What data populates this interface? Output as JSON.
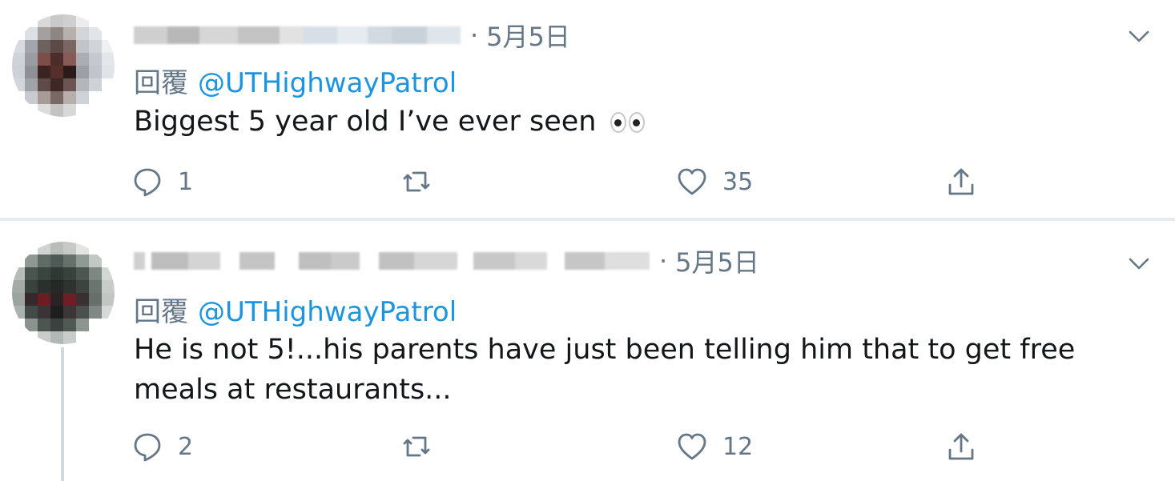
{
  "tweets": [
    {
      "separator": "·",
      "date": "5月5日",
      "reply_prefix": "回覆",
      "reply_handle": "@UTHighwayPatrol",
      "text": "Biggest 5 year old I’ve ever seen",
      "emoji": "eyes-emoji",
      "reply_count": "1",
      "retweet_count": "",
      "like_count": "35"
    },
    {
      "separator": "·",
      "date": "5月5日",
      "reply_prefix": "回覆",
      "reply_handle": "@UTHighwayPatrol",
      "text": "He is not 5!...his parents have just been telling him that to get free meals at restaurants...",
      "reply_count": "2",
      "retweet_count": "",
      "like_count": "12"
    }
  ],
  "icons": {
    "reply": "speech-bubble-icon",
    "retweet": "retweet-icon",
    "like": "heart-icon",
    "share": "share-icon",
    "menu": "chevron-down-icon"
  },
  "colors": {
    "link": "#1b95e0",
    "muted": "#657786",
    "text": "#14171a",
    "divider": "#e6ecf0"
  }
}
